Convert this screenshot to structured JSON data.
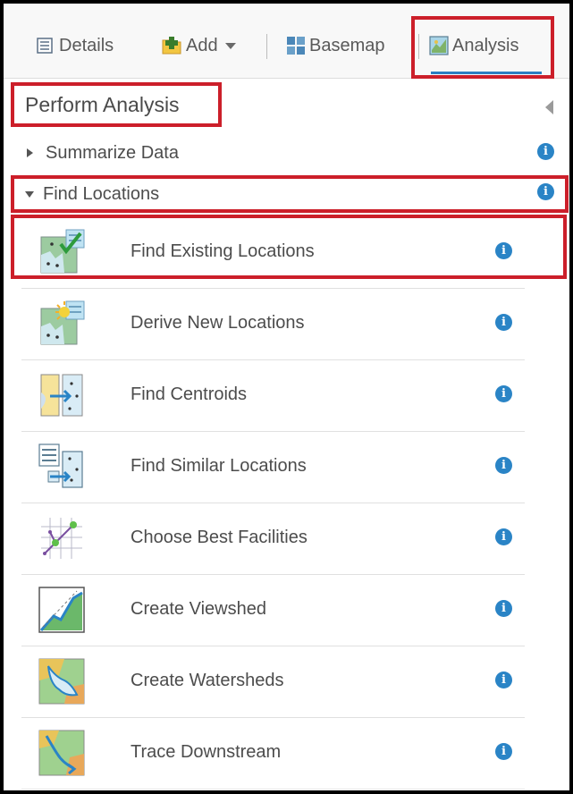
{
  "toolbar": {
    "details_label": "Details",
    "add_label": "Add",
    "basemap_label": "Basemap",
    "analysis_label": "Analysis"
  },
  "panel": {
    "title": "Perform Analysis",
    "groups": [
      {
        "label": "Summarize Data",
        "expanded": false
      },
      {
        "label": "Find Locations",
        "expanded": true
      }
    ],
    "tools": [
      {
        "label": "Find Existing Locations",
        "icon": "find-existing-locations-icon"
      },
      {
        "label": "Derive New Locations",
        "icon": "derive-new-locations-icon"
      },
      {
        "label": "Find Centroids",
        "icon": "find-centroids-icon"
      },
      {
        "label": "Find Similar Locations",
        "icon": "find-similar-locations-icon"
      },
      {
        "label": "Choose Best Facilities",
        "icon": "choose-best-facilities-icon"
      },
      {
        "label": "Create Viewshed",
        "icon": "create-viewshed-icon"
      },
      {
        "label": "Create Watersheds",
        "icon": "create-watersheds-icon"
      },
      {
        "label": "Trace Downstream",
        "icon": "trace-downstream-icon"
      }
    ]
  },
  "info_glyph": "i",
  "colors": {
    "accent": "#2a84c6",
    "highlight": "#cc1f2a",
    "selected_underline": "#2a7fc2"
  }
}
